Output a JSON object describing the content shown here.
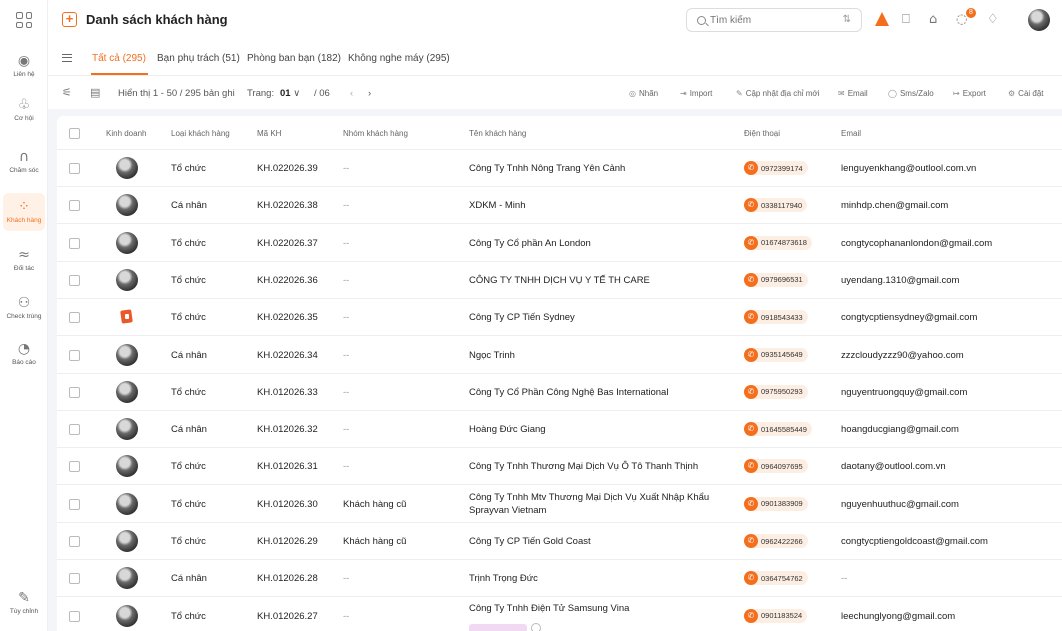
{
  "sidebar": {
    "items": [
      {
        "label": "Liên hệ",
        "icon": "contact-icon",
        "glyph": "◉"
      },
      {
        "label": "Cơ hội",
        "icon": "opportunity-icon",
        "glyph": "♧"
      },
      {
        "label": "Chăm sóc",
        "icon": "headset-icon",
        "glyph": "∩"
      },
      {
        "label": "Khách hàng",
        "icon": "customers-icon",
        "glyph": "⁘"
      },
      {
        "label": "Đối tác",
        "icon": "partner-icon",
        "glyph": "≈"
      },
      {
        "label": "Check trùng",
        "icon": "duplicate-check-icon",
        "glyph": "⚇"
      },
      {
        "label": "Báo cáo",
        "icon": "report-icon",
        "glyph": "◔"
      }
    ],
    "bottom": {
      "label": "Tùy chỉnh",
      "icon": "customize-icon",
      "glyph": "✎"
    }
  },
  "header": {
    "title": "Danh sách khách hàng",
    "search_placeholder": "Tìm kiếm",
    "notification_count": "8"
  },
  "tabs": [
    {
      "label": "Tất cả (295)",
      "active": true
    },
    {
      "label": "Bạn phụ trách (51)"
    },
    {
      "label": "Phòng ban bạn (182)"
    },
    {
      "label": "Không nghe máy (295)"
    }
  ],
  "toolbar": {
    "display_info": "Hiển thị 1 - 50 / 295 bản ghi",
    "page_label": "Trang:",
    "page_current": "01",
    "page_total": "/ 06",
    "actions": [
      "Nhãn",
      "Import",
      "Cập nhật địa chỉ mới",
      "Email",
      "Sms/Zalo",
      "Export",
      "Cài đặt"
    ]
  },
  "columns": [
    "Kinh doanh",
    "Loại khách hàng",
    "Mã KH",
    "Nhóm khách hàng",
    "Tên khách hàng",
    "Điện thoại",
    "Email"
  ],
  "rows": [
    {
      "type": "Tổ chức",
      "code": "KH.022026.39",
      "group": "--",
      "name": "Công Ty Tnhh Nông Trang Yên Cảnh",
      "phone": "0972399174",
      "email": "lenguyenkhang@outlool.com.vn"
    },
    {
      "type": "Cá nhân",
      "code": "KH.022026.38",
      "group": "--",
      "name": "XDKM - Minh",
      "phone": "0338117940",
      "email": "minhdp.chen@gmail.com"
    },
    {
      "type": "Tổ chức",
      "code": "KH.022026.37",
      "group": "--",
      "name": "Công Ty Cổ phần An London",
      "phone": "01674873618",
      "email": "congtycophananlondon@gmail.com"
    },
    {
      "type": "Tổ chức",
      "code": "KH.022026.36",
      "group": "--",
      "name": "CÔNG TY TNHH DỊCH VỤ Y TẾ TH CARE",
      "phone": "0979696531",
      "email": "uyendang.1310@gmail.com"
    },
    {
      "type": "Tổ chức",
      "code": "KH.022026.35",
      "group": "--",
      "name": "Công Ty CP Tiến Sydney",
      "phone": "0918543433",
      "email": "congtycptiensydney@gmail.com",
      "logo": true
    },
    {
      "type": "Cá nhân",
      "code": "KH.022026.34",
      "group": "--",
      "name": "Ngọc Trinh",
      "phone": "0935145649",
      "email": "zzzcloudyzzz90@yahoo.com"
    },
    {
      "type": "Tổ chức",
      "code": "KH.012026.33",
      "group": "--",
      "name": "Công Ty Cổ Phần Công Nghệ Bas International",
      "phone": "0975950293",
      "email": "nguyentruongquy@gmail.com"
    },
    {
      "type": "Cá nhân",
      "code": "KH.012026.32",
      "group": "--",
      "name": "Hoàng Đức Giang",
      "phone": "01645585449",
      "email": "hoangducgiang@gmail.com"
    },
    {
      "type": "Tổ chức",
      "code": "KH.012026.31",
      "group": "--",
      "name": "Công Ty Tnhh Thương Mại Dịch Vụ Ô Tô Thanh Thịnh",
      "phone": "0964097695",
      "email": "daotany@outlool.com.vn"
    },
    {
      "type": "Tổ chức",
      "code": "KH.012026.30",
      "group": "Khách hàng cũ",
      "name": "Công Ty Tnhh Mtv Thương Mại Dịch Vụ Xuất Nhập Khẩu Sprayvan Vietnam",
      "phone": "0901383909",
      "email": "nguyenhuuthuc@gmail.com",
      "wrap": true
    },
    {
      "type": "Tổ chức",
      "code": "KH.012026.29",
      "group": "Khách hàng cũ",
      "name": "Công Ty CP Tiến Gold Coast",
      "phone": "0962422266",
      "email": "congtycptiengoldcoast@gmail.com"
    },
    {
      "type": "Cá nhân",
      "code": "KH.012026.28",
      "group": "--",
      "name": "Trịnh Trọng Đức",
      "phone": "0364754762",
      "email": "--"
    },
    {
      "type": "Tổ chức",
      "code": "KH.012026.27",
      "group": "--",
      "name": "Công Ty Tnhh Điện Tử Samsung Vina",
      "phone": "0901183524",
      "email": "leechunglyong@gmail.com",
      "tag": true
    }
  ]
}
